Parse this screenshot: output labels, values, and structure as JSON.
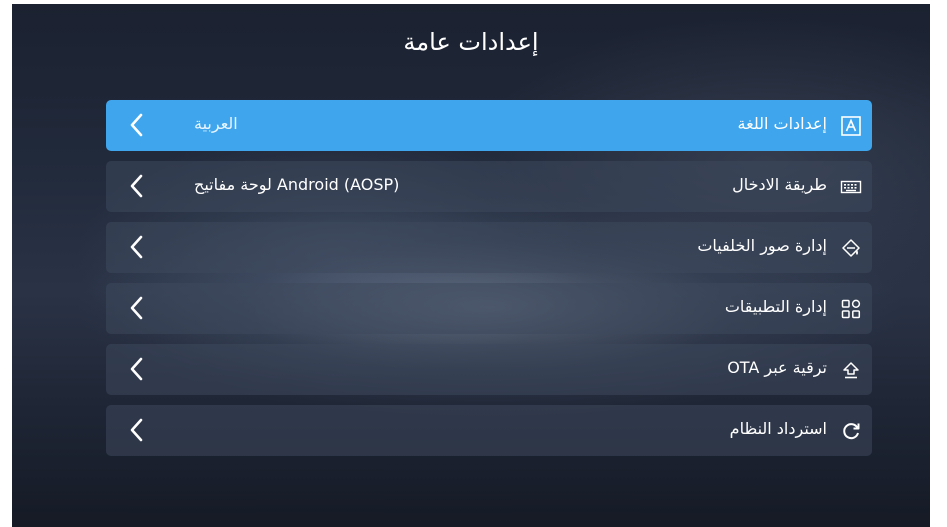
{
  "title": "إعدادات عامة",
  "colors": {
    "accent": "#3fa6ee",
    "row_background": "#3e485c",
    "text": "#ffffff"
  },
  "menu": {
    "items": [
      {
        "label": "إعدادات اللغة",
        "value": "العربية",
        "icon": "language-icon",
        "selected": true
      },
      {
        "label": "طريقة الادخال",
        "value": "لوحة مفاتيح Android (AOSP)",
        "icon": "keyboard-icon",
        "selected": false
      },
      {
        "label": "إدارة صور الخلفيات",
        "value": "",
        "icon": "wallpaper-icon",
        "selected": false
      },
      {
        "label": "إدارة التطبيقات",
        "value": "",
        "icon": "apps-grid-icon",
        "selected": false
      },
      {
        "label": "ترقية عبر OTA",
        "value": "",
        "icon": "ota-upgrade-icon",
        "selected": false
      },
      {
        "label": "استرداد النظام",
        "value": "",
        "icon": "restore-icon",
        "selected": false
      }
    ]
  }
}
